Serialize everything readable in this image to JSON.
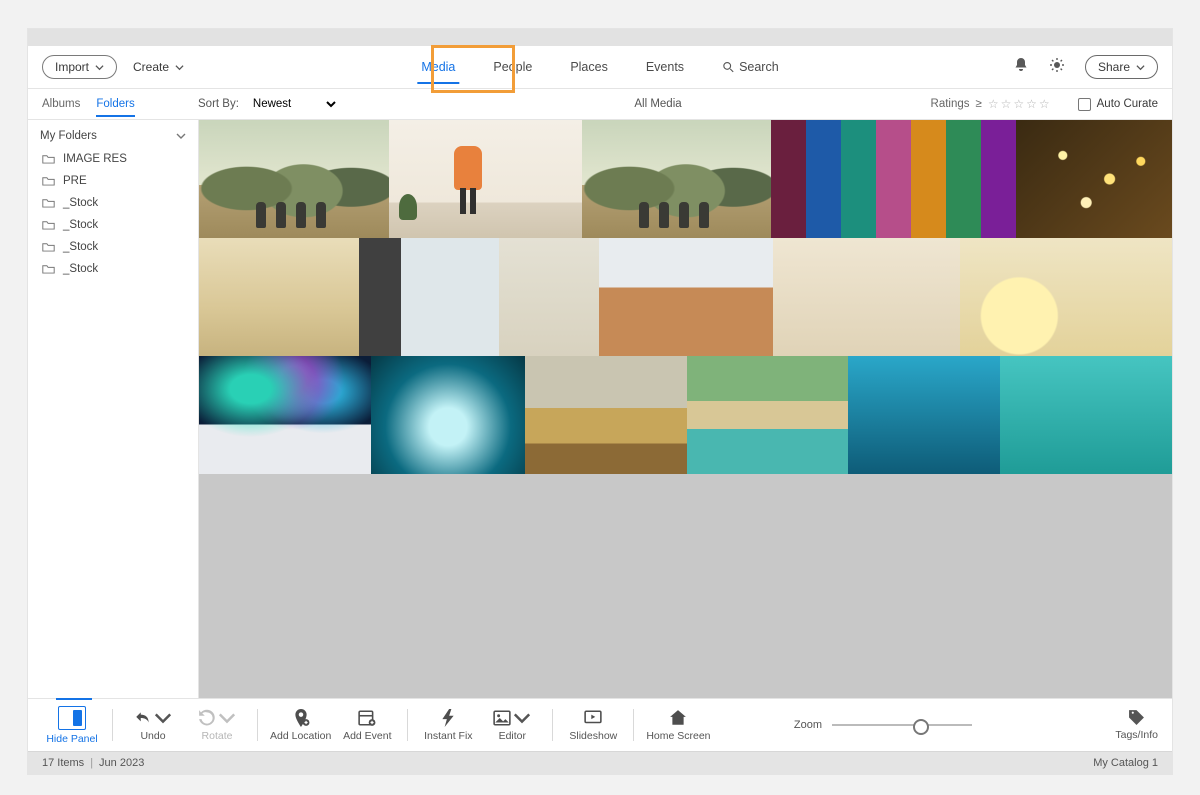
{
  "topbar": {
    "import_label": "Import",
    "create_label": "Create",
    "tabs": {
      "media": "Media",
      "people": "People",
      "places": "Places",
      "events": "Events",
      "search": "Search"
    },
    "share_label": "Share"
  },
  "secbar": {
    "albums_label": "Albums",
    "folders_label": "Folders",
    "sortby_label": "Sort By:",
    "sort_value": "Newest",
    "center_label": "All Media",
    "ratings_label": "Ratings",
    "ratings_op": "≥",
    "autocurate_label": "Auto Curate"
  },
  "sidebar": {
    "group_label": "My Folders",
    "items": [
      {
        "label": "IMAGE RES"
      },
      {
        "label": "PRE"
      },
      {
        "label": "_Stock"
      },
      {
        "label": "_Stock"
      },
      {
        "label": "_Stock"
      },
      {
        "label": "_Stock"
      }
    ]
  },
  "actions": {
    "hidepanel": "Hide Panel",
    "undo": "Undo",
    "rotate": "Rotate",
    "addlocation": "Add Location",
    "addevent": "Add Event",
    "instantfix": "Instant Fix",
    "editor": "Editor",
    "slideshow": "Slideshow",
    "homescreen": "Home Screen",
    "zoom": "Zoom",
    "tagsinfo": "Tags/Info"
  },
  "status": {
    "items": "17 Items",
    "date": "Jun 2023",
    "catalog": "My Catalog 1"
  }
}
